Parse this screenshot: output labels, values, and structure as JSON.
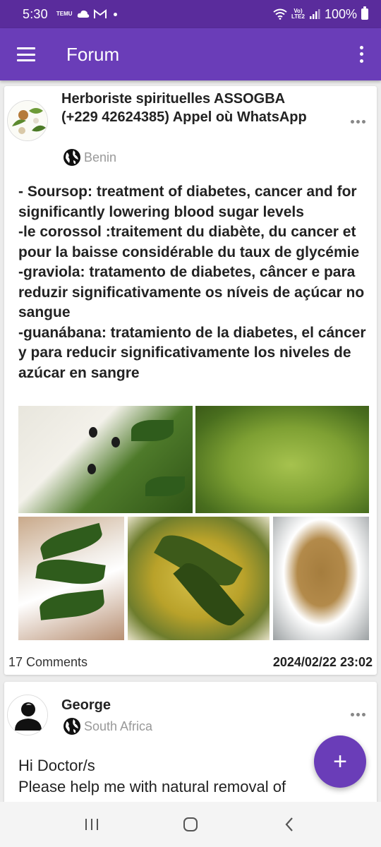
{
  "status_bar": {
    "time": "5:30",
    "temu_label": "TEMU",
    "volte_label_top": "Vo)",
    "volte_label_bottom": "LTE2",
    "battery": "100%"
  },
  "app_bar": {
    "title": "Forum",
    "menu_icon": "hamburger-menu-icon",
    "overflow_icon": "more-vert-icon"
  },
  "posts": [
    {
      "author": "Herboriste spirituelles ASSOGBA (+229 42624385) Appel où WhatsApp",
      "location": "Benin",
      "body_lines": [
        "- Soursop: treatment of diabetes, cancer and for significantly lowering blood sugar levels",
        "-le corossol :traitement du diabète, du cancer et pour la baisse considérable du taux de glycémie",
        "-graviola: tratamento de diabetes, câncer e para reduzir significativamente os níveis de açúcar no sangue",
        "-guanábana: tratamiento de la diabetes, el cáncer y para reducir significativamente los niveles de azúcar en sangre"
      ],
      "comments": "17 Comments",
      "date": "2024/02/22 23:02"
    },
    {
      "author": "George",
      "location": "South Africa",
      "body": "Hi Doctor/s\nPlease help me with natural removal of"
    }
  ],
  "fab_label": "+",
  "colors": {
    "primary": "#6a3db8",
    "status_bar": "#5a2c9c",
    "location_text": "#999999"
  }
}
